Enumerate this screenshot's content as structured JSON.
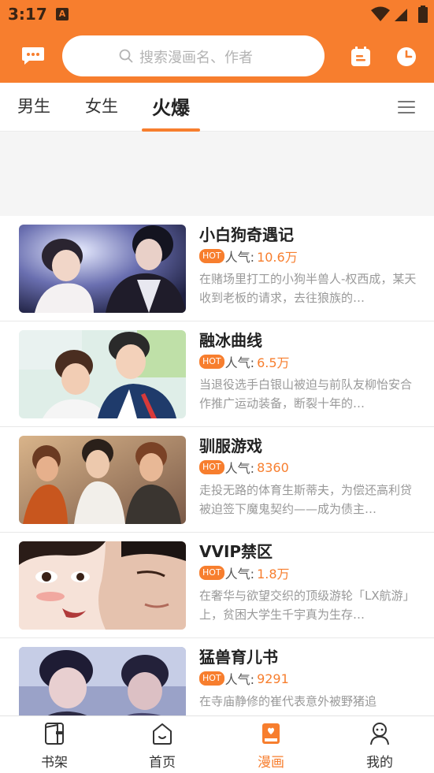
{
  "status_bar": {
    "time": "3:17",
    "notification_glyph": "A"
  },
  "header": {
    "search_placeholder": "搜索漫画名、作者",
    "left_icon": "message-icon",
    "right_icons": [
      "calendar-icon",
      "history-clock-icon"
    ]
  },
  "tabs": {
    "items": [
      {
        "label": "男生"
      },
      {
        "label": "女生"
      },
      {
        "label": "火爆"
      }
    ],
    "active_index": 2
  },
  "comics": [
    {
      "title": "小白狗奇遇记",
      "badge": "HOT",
      "popularity_label": "人气:",
      "popularity": "10.6万",
      "description": "在赌场里打工的小狗半兽人-权西成，某天收到老板的请求，去往狼族的…"
    },
    {
      "title": "融冰曲线",
      "badge": "HOT",
      "popularity_label": "人气:",
      "popularity": "6.5万",
      "description": "当退役选手白银山被迫与前队友柳怡安合作推广运动装备，断裂十年的…"
    },
    {
      "title": "驯服游戏",
      "badge": "HOT",
      "popularity_label": "人气:",
      "popularity": "8360",
      "description": "走投无路的体育生斯蒂夫，为偿还高利贷被迫签下魔鬼契约——成为债主…"
    },
    {
      "title": "VVIP禁区",
      "badge": "HOT",
      "popularity_label": "人气:",
      "popularity": "1.8万",
      "description": "在奢华与欲望交织的顶级游轮「LX航游」上，贫困大学生千宇真为生存…"
    },
    {
      "title": "猛兽育儿书",
      "badge": "HOT",
      "popularity_label": "人气:",
      "popularity": "9291",
      "description": "在寺庙静修的崔代表意外被野猪追"
    }
  ],
  "bottom_nav": {
    "items": [
      {
        "label": "书架",
        "icon": "bookshelf-icon"
      },
      {
        "label": "首页",
        "icon": "home-icon"
      },
      {
        "label": "漫画",
        "icon": "comic-book-icon"
      },
      {
        "label": "我的",
        "icon": "profile-icon"
      }
    ],
    "active_index": 2
  },
  "colors": {
    "accent": "#f77e2e",
    "text_dark": "#222222",
    "text_muted": "#999999"
  }
}
